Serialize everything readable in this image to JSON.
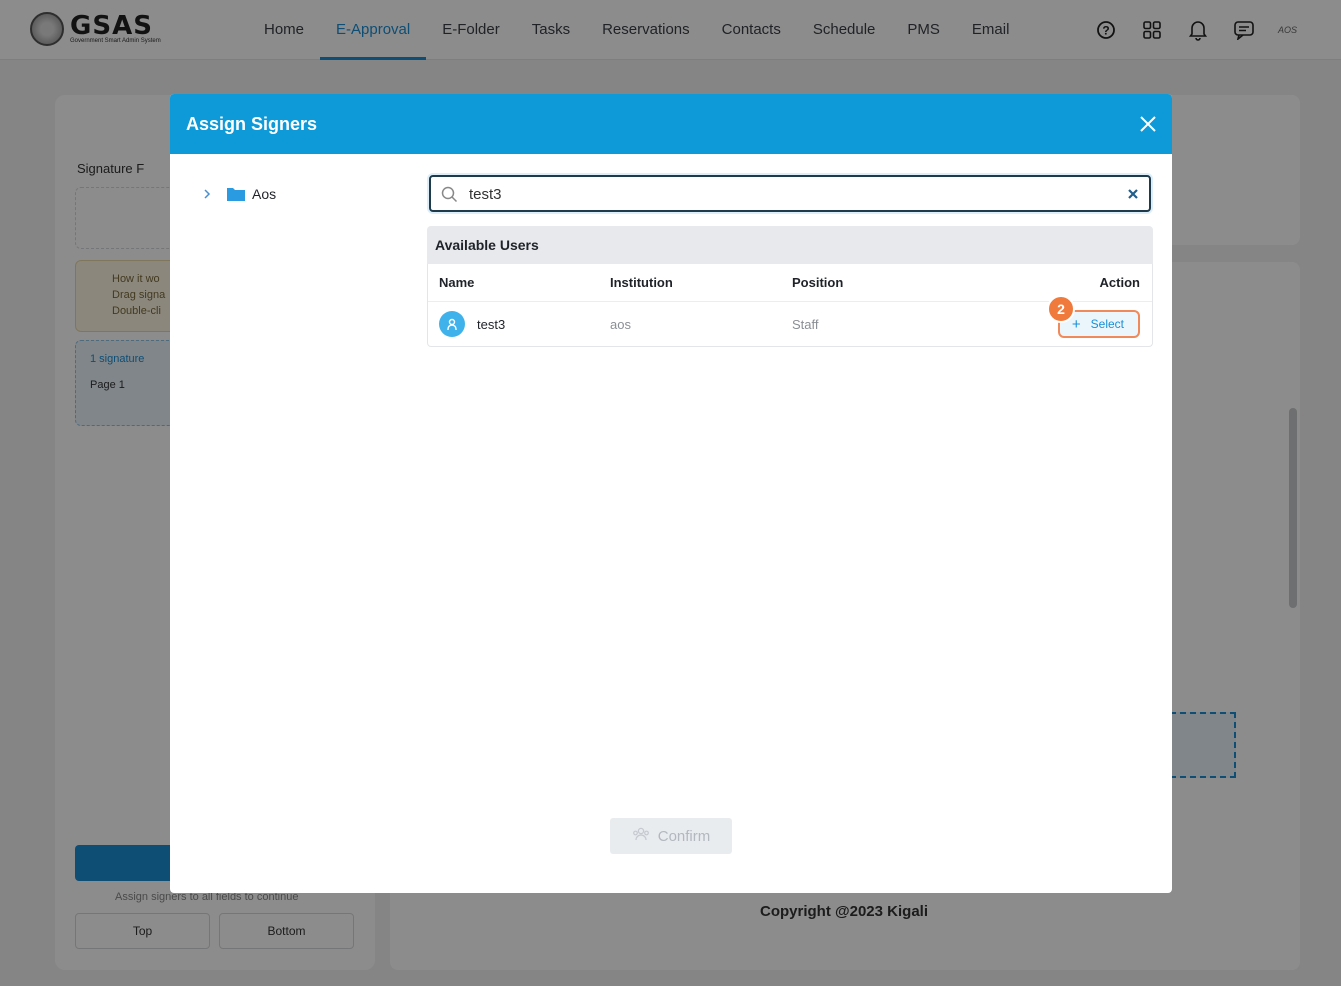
{
  "nav": {
    "logo_title": "GSAS",
    "logo_subtitle": "Government Smart Admin System",
    "items": [
      "Home",
      "E-Approval",
      "E-Folder",
      "Tasks",
      "Reservations",
      "Contacts",
      "Schedule",
      "PMS",
      "Email"
    ],
    "active": "E-Approval",
    "user": "AOS"
  },
  "background": {
    "left_title": "Signature F",
    "tip_line1": "How it wo",
    "tip_line2": "Drag signa",
    "tip_line3": "Double-cli",
    "status": "1 signature",
    "page": "Page 1",
    "note": "Assign signers to all fields to continue",
    "top_label": "Top",
    "bottom_label": "Bottom",
    "copyright": "Copyright @2023 Kigali"
  },
  "modal": {
    "title": "Assign Signers",
    "tree_item": "Aos",
    "search_value": "test3",
    "section_title": "Available Users",
    "columns": [
      "Name",
      "Institution",
      "Position",
      "Action"
    ],
    "rows": [
      {
        "name": "test3",
        "institution": "aos",
        "position": "Staff",
        "action": "Select"
      }
    ],
    "badge": "2",
    "confirm_label": "Confirm"
  },
  "colors": {
    "primary": "#0e9ad8",
    "accent": "#1a8fd6",
    "highlight": "#f07a3c"
  }
}
